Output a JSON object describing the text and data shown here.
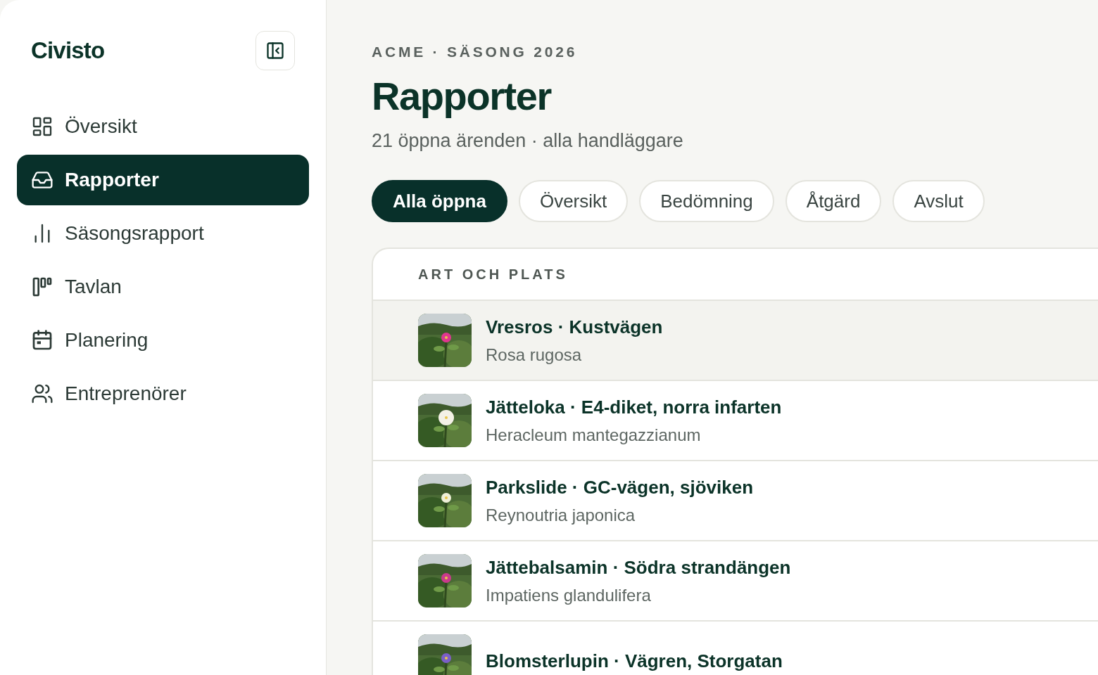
{
  "sidebar": {
    "logo": "Civisto",
    "items": [
      {
        "label": "Översikt",
        "selected": false
      },
      {
        "label": "Rapporter",
        "selected": true
      },
      {
        "label": "Säsongsrapport",
        "selected": false
      },
      {
        "label": "Tavlan",
        "selected": false
      },
      {
        "label": "Planering",
        "selected": false
      },
      {
        "label": "Entreprenörer",
        "selected": false
      }
    ]
  },
  "header": {
    "eyebrow": "ACME · SÄSONG 2026",
    "title": "Rapporter",
    "subtitle": "21 öppna ärenden · alla handläggare"
  },
  "filters": [
    {
      "label": "Alla öppna",
      "selected": true
    },
    {
      "label": "Översikt",
      "selected": false
    },
    {
      "label": "Bedömning",
      "selected": false
    },
    {
      "label": "Åtgärd",
      "selected": false
    },
    {
      "label": "Avslut",
      "selected": false
    }
  ],
  "table": {
    "column_header": "ART OCH PLATS",
    "rows": [
      {
        "title": "Vresros · Kustvägen",
        "subtitle": "Rosa rugosa",
        "selected": true
      },
      {
        "title": "Jätteloka · E4-diket, norra infarten",
        "subtitle": "Heracleum mantegazzianum",
        "selected": false
      },
      {
        "title": "Parkslide · GC-vägen, sjöviken",
        "subtitle": "Reynoutria japonica",
        "selected": false
      },
      {
        "title": "Jättebalsamin · Södra strandängen",
        "subtitle": "Impatiens glandulifera",
        "selected": false
      },
      {
        "title": "Blomsterlupin · Vägren, Storgatan",
        "selected": false
      }
    ]
  }
}
